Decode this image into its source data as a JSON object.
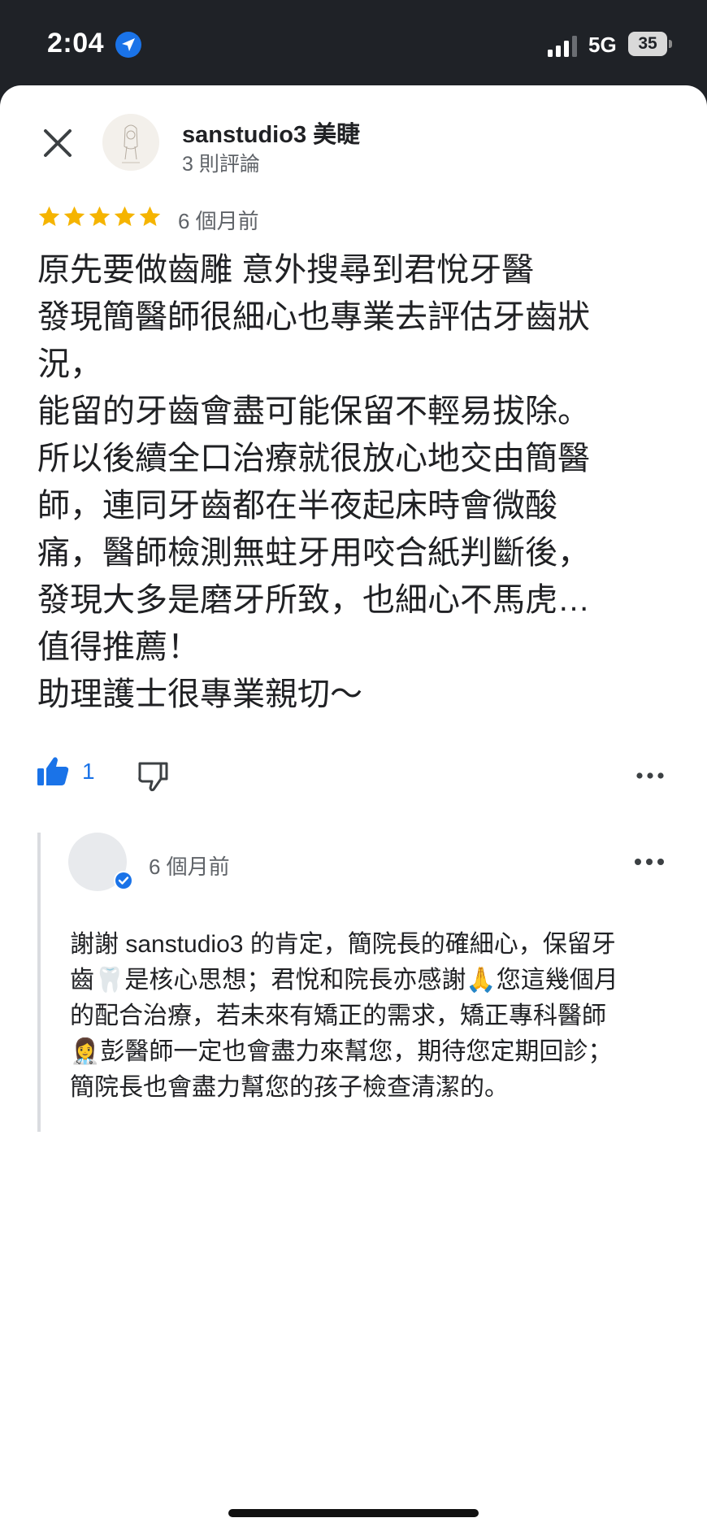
{
  "status_bar": {
    "time": "2:04",
    "network": "5G",
    "battery": "35"
  },
  "review": {
    "author": "sanstudio3 美睫",
    "author_meta": "3 則評論",
    "rating": 5,
    "time": "6 個月前",
    "text": "原先要做齒雕 意外搜尋到君悅牙醫\n發現簡醫師很細心也專業去評估牙齒狀\n況，\n能留的牙齒會盡可能保留不輕易拔除。\n所以後續全口治療就很放心地交由簡醫\n師，連同牙齒都在半夜起床時會微酸\n痛，醫師檢測無蛀牙用咬合紙判斷後，\n發現大多是磨牙所致，也細心不馬虎…\n值得推薦！\n助理護士很專業親切～",
    "like_count": "1"
  },
  "owner_reply": {
    "time": "6 個月前",
    "text": "謝謝 sanstudio3 的肯定，簡院長的確細心，保留牙\n齒🦷是核心思想；君悅和院長亦感謝🙏您這幾個月\n的配合治療，若未來有矯正的需求，矯正專科醫師\n👩‍⚕️彭醫師一定也會盡力來幫您，期待您定期回診；\n簡院長也會盡力幫您的孩子檢查清潔的。"
  },
  "colors": {
    "star": "#f5b400",
    "accent": "#1a73e8",
    "text": "#202124",
    "secondary": "#5f6368"
  },
  "icons": [
    "location-arrow-icon",
    "signal-icon",
    "battery-icon",
    "close-icon",
    "star-icon",
    "thumbs-up-icon",
    "thumbs-down-icon",
    "more-horizontal-icon",
    "verified-badge-icon"
  ]
}
